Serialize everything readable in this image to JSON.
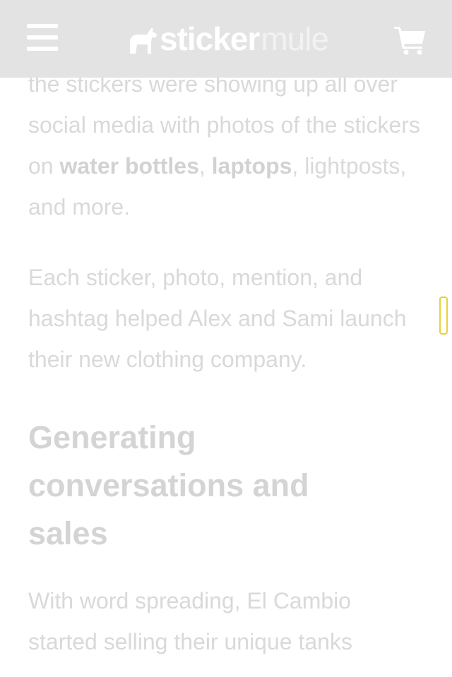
{
  "header": {
    "brand_part1": "sticker",
    "brand_part2": "mule",
    "menu_icon": "hamburger-menu-icon",
    "cart_icon": "shopping-cart-icon",
    "header_color": "#e3e3e3"
  },
  "article": {
    "para1": {
      "text_a": "the stickers were showing up all over social media with photos of the stickers on ",
      "bold_a": "water bottles",
      "text_b": ", ",
      "bold_b": "laptops",
      "text_c": ", lightposts, and more."
    },
    "para2": "Each sticker, photo, mention, and hashtag helped Alex and Sami launch their new clothing company.",
    "heading": "Generating conversations and sales",
    "para3": "With word spreading, El Cambio started selling their unique tanks"
  },
  "colors": {
    "faded_text": "#d9d9d9",
    "scroll_accent": "#e8d23a"
  }
}
